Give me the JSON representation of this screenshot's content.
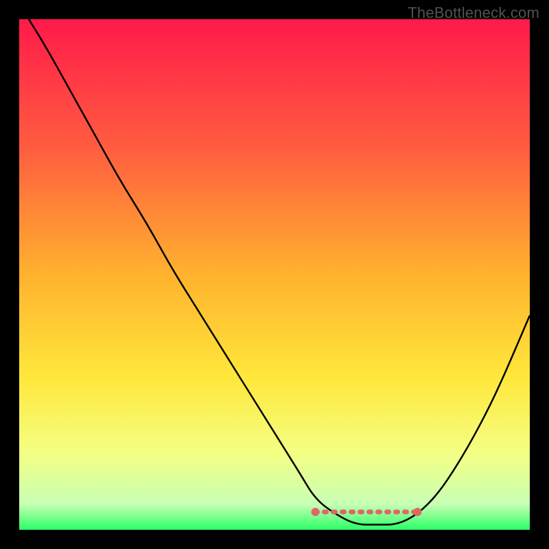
{
  "watermark": "TheBottleneck.com",
  "chart_data": {
    "type": "line",
    "title": "",
    "xlabel": "",
    "ylabel": "",
    "xlim": [
      0,
      100
    ],
    "ylim": [
      0,
      100
    ],
    "grid": false,
    "legend": false,
    "background_gradient": {
      "stops": [
        {
          "y": 0,
          "color": "#ff1a4a"
        },
        {
          "y": 25,
          "color": "#ff5c40"
        },
        {
          "y": 50,
          "color": "#ffb22e"
        },
        {
          "y": 70,
          "color": "#ffe73a"
        },
        {
          "y": 85,
          "color": "#f4ff84"
        },
        {
          "y": 95,
          "color": "#c8ffb4"
        },
        {
          "y": 100,
          "color": "#2bff66"
        }
      ]
    },
    "series": [
      {
        "name": "bottleneck-curve",
        "color": "#000000",
        "x": [
          0,
          5,
          10,
          15,
          20,
          25,
          30,
          35,
          40,
          45,
          50,
          55,
          58,
          62,
          66,
          70,
          74,
          78,
          82,
          86,
          90,
          94,
          100
        ],
        "values": [
          103,
          95,
          86,
          77,
          68,
          60,
          51,
          43,
          35,
          27,
          19,
          11,
          6,
          3,
          1,
          1,
          1,
          3,
          7,
          13,
          20,
          28,
          42
        ]
      }
    ],
    "flat_marker": {
      "color": "#e06666",
      "y": 3.5,
      "x_start": 58,
      "x_end": 78,
      "endpoint_radius": 4
    }
  }
}
